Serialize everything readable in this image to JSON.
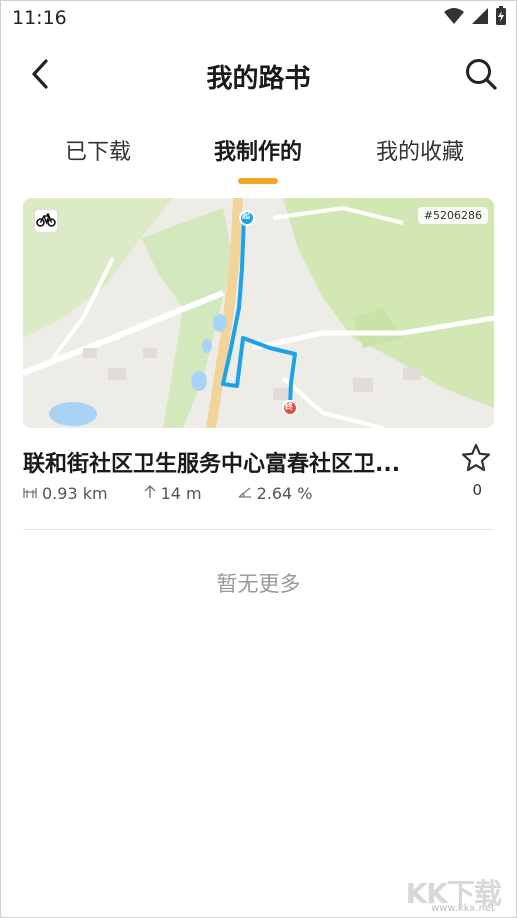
{
  "status_bar": {
    "time": "11:16",
    "icons": [
      "wifi-icon",
      "signal-icon",
      "battery-charging-icon"
    ]
  },
  "header": {
    "title": "我的路书",
    "back_icon": "back-arrow-icon",
    "search_icon": "search-icon"
  },
  "tabs": [
    {
      "label": "已下载",
      "active": false
    },
    {
      "label": "我制作的",
      "active": true
    },
    {
      "label": "我的收藏",
      "active": false
    }
  ],
  "accent_color": "#f5a623",
  "route_color": "#1aa3ea",
  "route": {
    "id": "#5206286",
    "type_icon": "bicycle-icon",
    "title": "联和街社区卫生服务中心富春社区卫...",
    "favorite_count": "0",
    "distance": "0.93 km",
    "elevation": "14 m",
    "grade": "2.64 %",
    "start_marker": "起",
    "end_marker": "终"
  },
  "empty_text": "暂无更多",
  "watermark": {
    "logo": "KK下载",
    "url": "www.kkx.net"
  }
}
